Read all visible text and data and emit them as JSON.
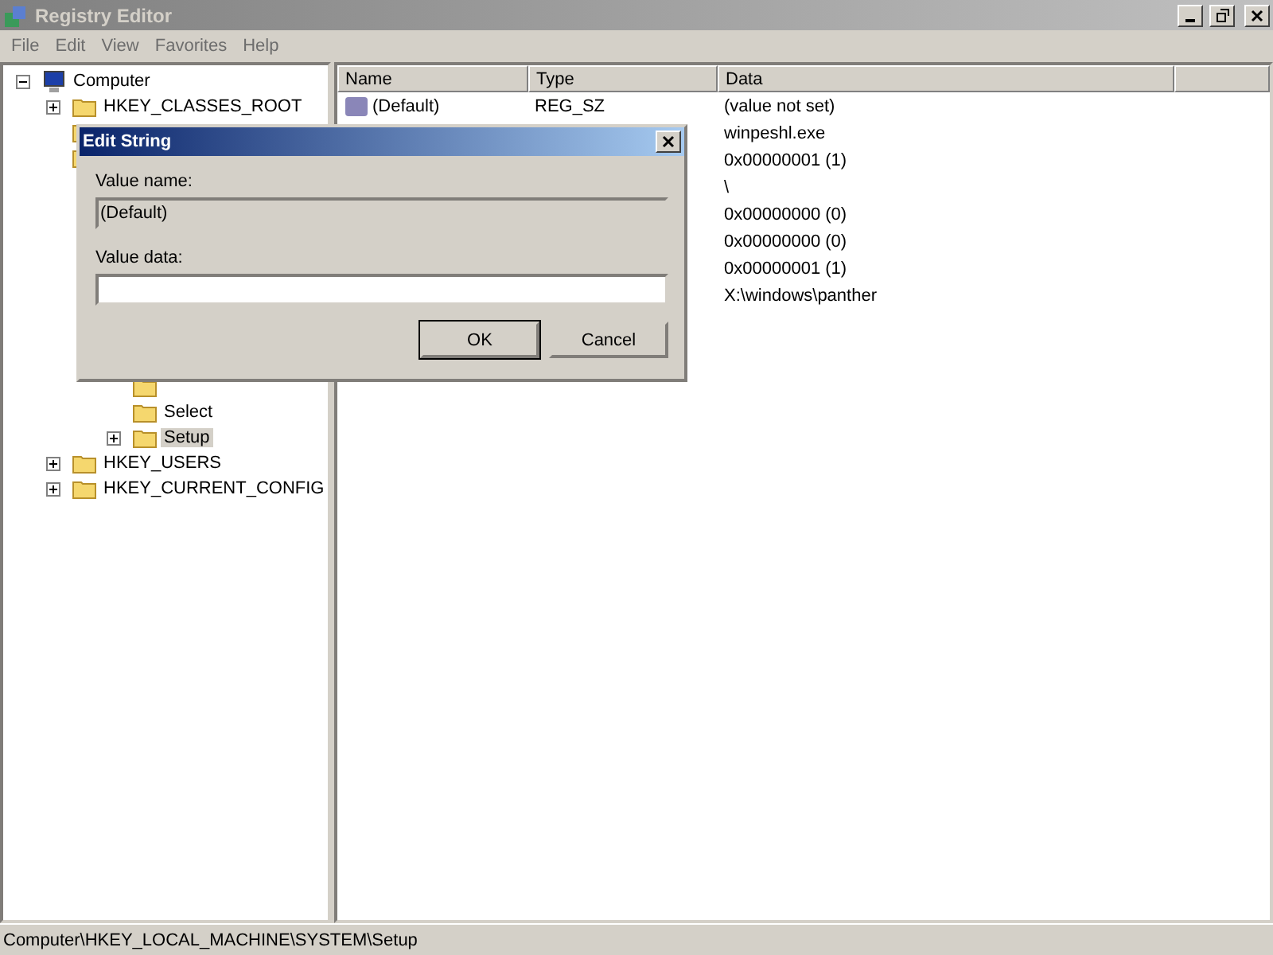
{
  "window": {
    "title": "Registry Editor",
    "active": false
  },
  "menu": [
    "File",
    "Edit",
    "View",
    "Favorites",
    "Help"
  ],
  "tree": [
    {
      "label": "Computer",
      "kind": "computer",
      "expanded": true,
      "selected": false,
      "children": [
        {
          "label": "HKEY_CLASSES_ROOT",
          "kind": "folder",
          "expanded": false,
          "selected": false
        },
        {
          "kind": "folder"
        },
        {
          "kind": "folder",
          "children": [
            {
              "kind": "covered"
            },
            {
              "kind": "covered"
            },
            {
              "kind": "covered"
            },
            {
              "kind": "covered"
            },
            {
              "kind": "covered",
              "children": [
                {
                  "kind": "covered"
                },
                {
                  "kind": "covered"
                },
                {
                  "kind": "covered"
                },
                {
                  "kind": "folder"
                },
                {
                  "label": "Select",
                  "kind": "folder",
                  "selected": false
                },
                {
                  "label": "Setup",
                  "kind": "folder",
                  "expanded": false,
                  "selected": true
                }
              ]
            }
          ]
        },
        {
          "label": "HKEY_USERS",
          "kind": "folder",
          "expanded": false,
          "selected": false
        },
        {
          "label": "HKEY_CURRENT_CONFIG",
          "kind": "folder",
          "expanded": false,
          "selected": false
        }
      ]
    }
  ],
  "list": {
    "columns": [
      "Name",
      "Type",
      "Data"
    ],
    "rows": [
      {
        "name": "(Default)",
        "type": "REG_SZ",
        "data": "(value not set)"
      },
      {
        "data": "winpeshl.exe"
      },
      {
        "data": "0x00000001 (1)"
      },
      {
        "data": "\\"
      },
      {
        "data": "0x00000000 (0)"
      },
      {
        "data": "0x00000000 (0)"
      },
      {
        "data": "0x00000001 (1)"
      },
      {
        "data": "X:\\windows\\panther"
      }
    ]
  },
  "dialog": {
    "title": "Edit String",
    "name_label": "Value name:",
    "name_value": "(Default)",
    "data_label": "Value data:",
    "buttons": [
      {
        "label": "OK",
        "default": true
      },
      {
        "label": "Cancel",
        "default": false
      }
    ]
  },
  "status_bar": "Computer\\HKEY_LOCAL_MACHINE\\SYSTEM\\Setup"
}
